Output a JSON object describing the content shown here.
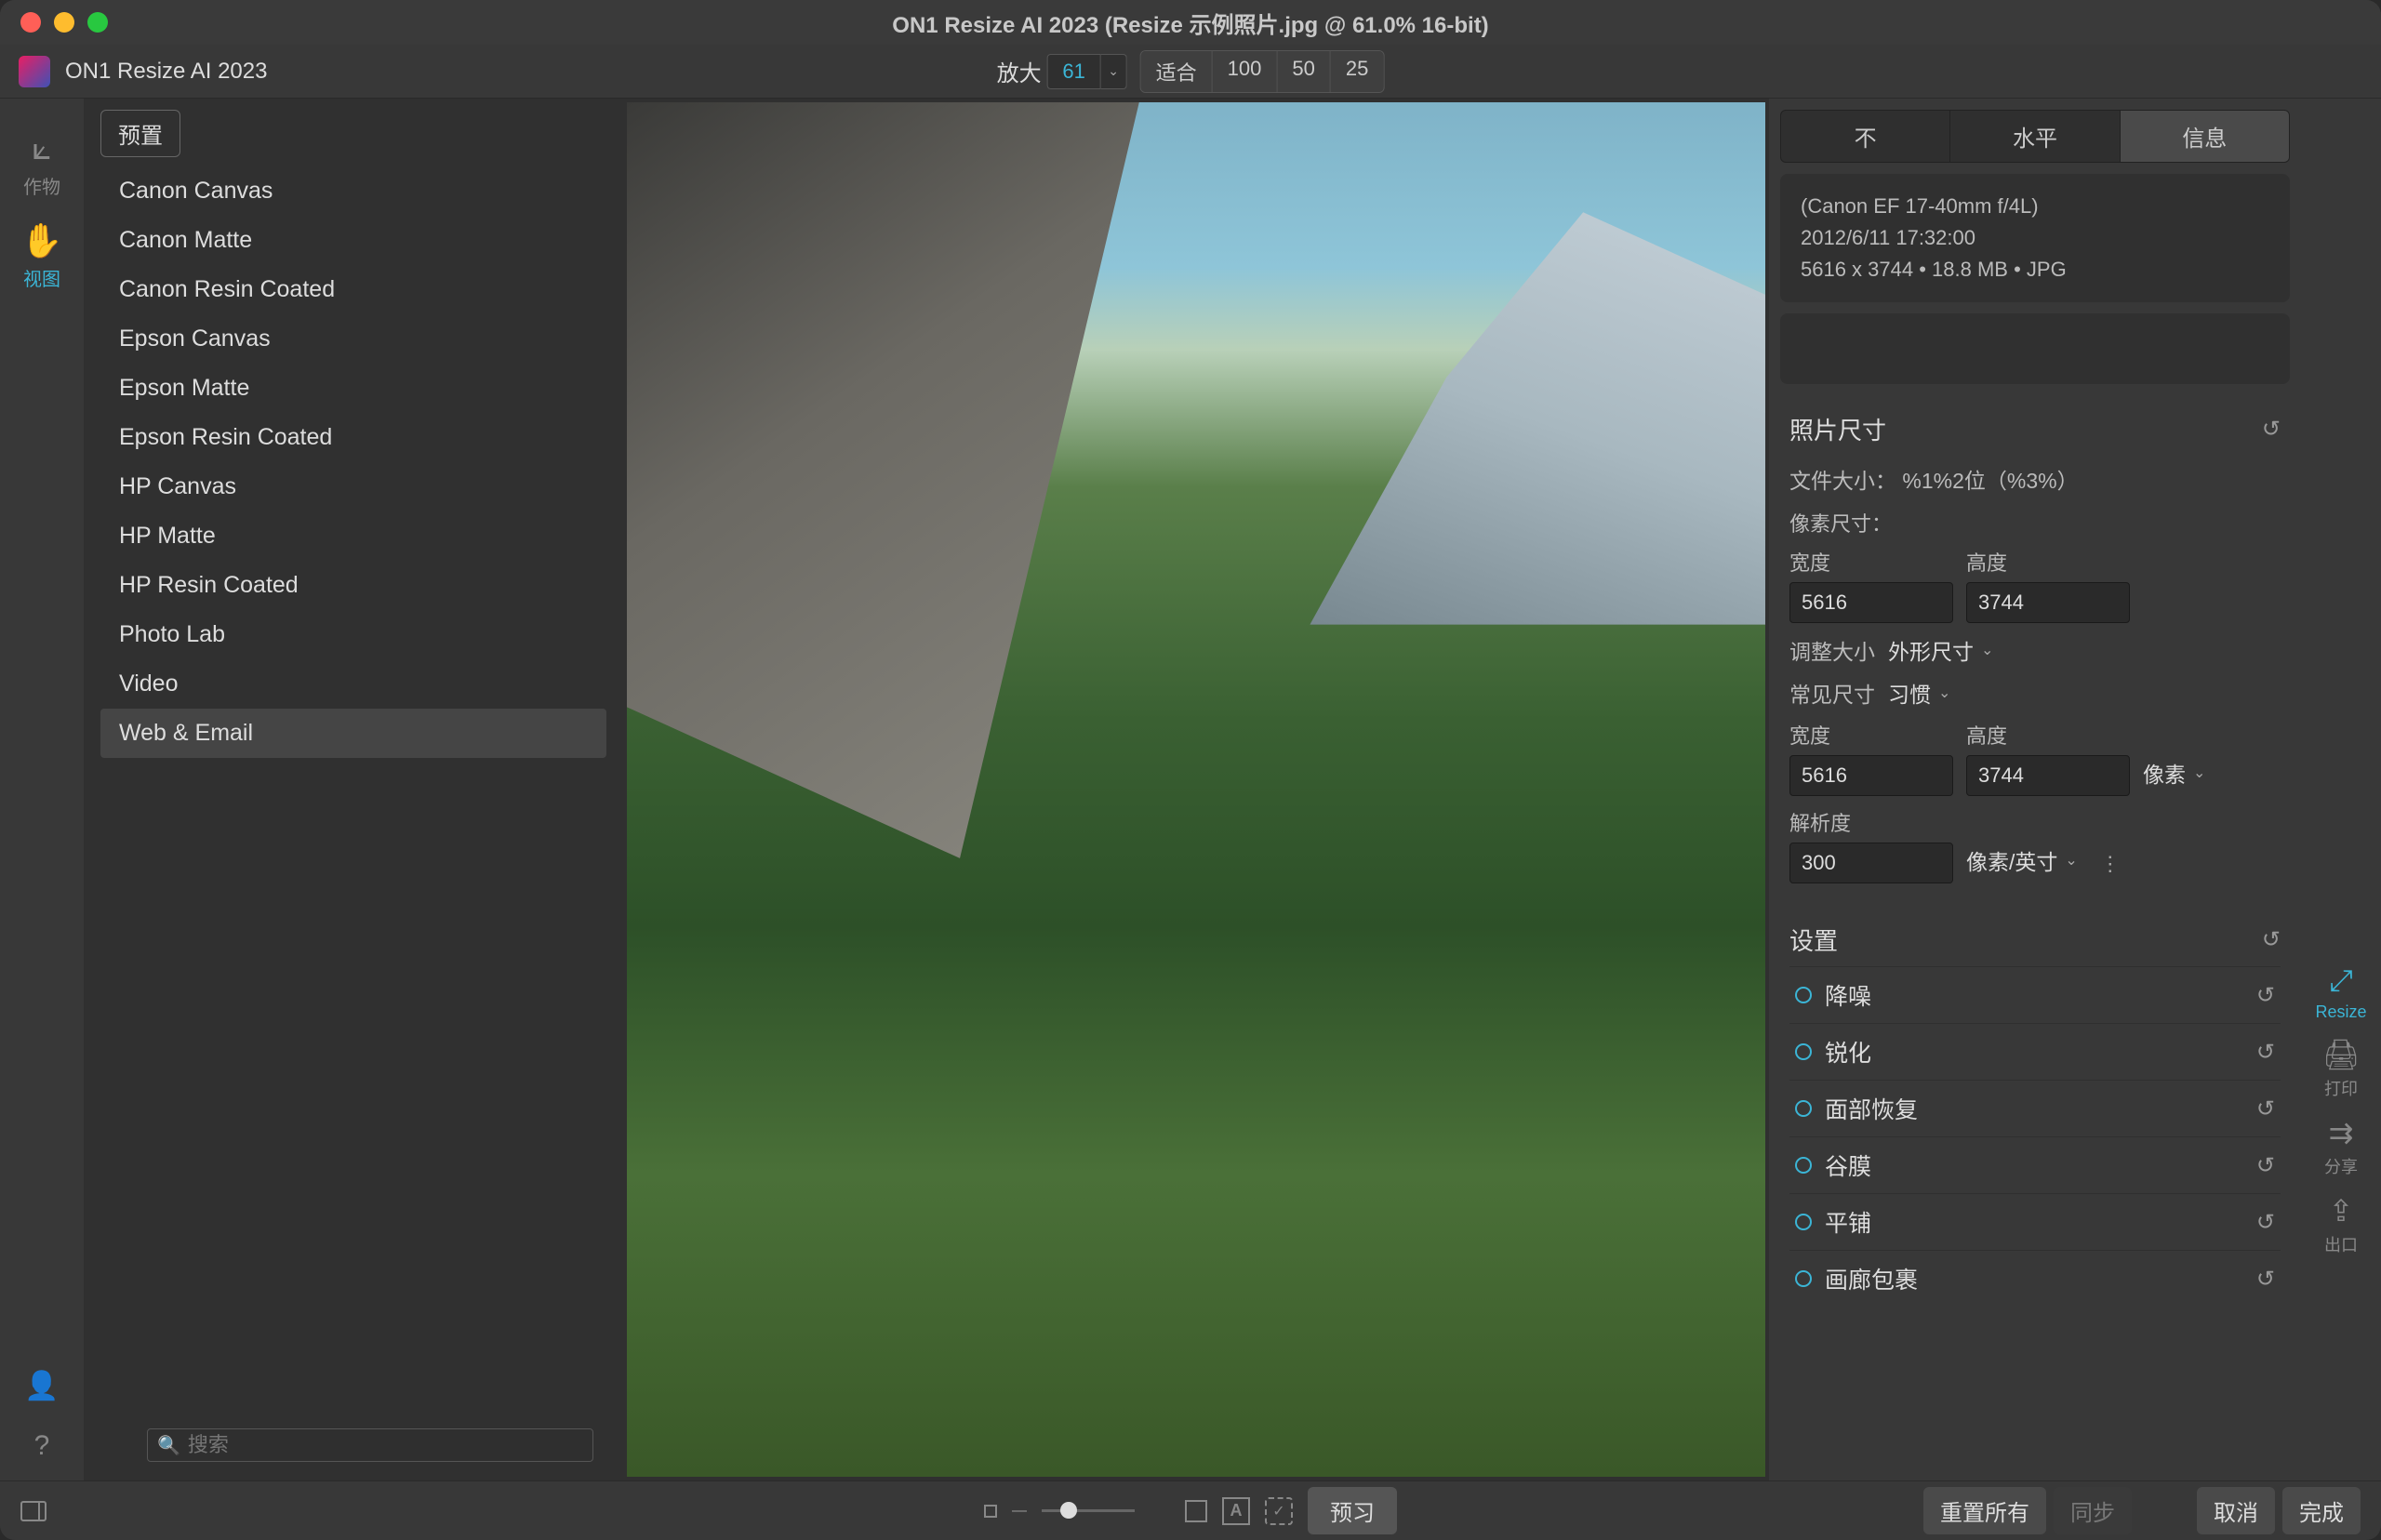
{
  "title": "ON1 Resize AI 2023 (Resize 示例照片.jpg @ 61.0% 16-bit)",
  "app_name": "ON1 Resize AI 2023",
  "toolbar": {
    "zoom_label": "放大",
    "zoom_value": "61",
    "zoom_buttons": [
      "适合",
      "100",
      "50",
      "25"
    ]
  },
  "left_rail": {
    "items": [
      {
        "label": "作物",
        "active": false
      },
      {
        "label": "视图",
        "active": true
      }
    ]
  },
  "presets": {
    "header": "预置",
    "items": [
      "Canon Canvas",
      "Canon Matte",
      "Canon Resin Coated",
      "Epson Canvas",
      "Epson Matte",
      "Epson Resin Coated",
      "HP Canvas",
      "HP Matte",
      "HP Resin Coated",
      "Photo Lab",
      "Video",
      "Web & Email"
    ],
    "selected_index": 11,
    "search_placeholder": "搜索"
  },
  "right_tabs": [
    "不",
    "水平",
    "信息"
  ],
  "right_tab_active": 2,
  "info": {
    "lens": "(Canon EF 17-40mm f/4L)",
    "datetime": "2012/6/11  17:32:00",
    "dims_line": "5616 x 3744  •  18.8 MB  •  JPG"
  },
  "photo_size": {
    "title": "照片尺寸",
    "file_size_label": "文件大小：  %1%2位（%3%）",
    "pixel_dims_label": "像素尺寸：",
    "width_label": "宽度",
    "height_label": "高度",
    "width_value": "5616",
    "height_value": "3744",
    "resize_label": "调整大小",
    "resize_mode": "外形尺寸",
    "common_label": "常见尺寸",
    "common_value": "习惯",
    "width_value2": "5616",
    "height_value2": "3744",
    "unit": "像素",
    "resolution_label": "解析度",
    "resolution_value": "300",
    "res_unit": "像素/英寸"
  },
  "settings": {
    "title": "设置",
    "items": [
      "降噪",
      "锐化",
      "面部恢复",
      "谷膜",
      "平铺",
      "画廊包裹"
    ]
  },
  "right_rail": {
    "items": [
      {
        "label": "Resize",
        "active": true
      },
      {
        "label": "打印",
        "active": false
      },
      {
        "label": "分享",
        "active": false
      },
      {
        "label": "出口",
        "active": false
      }
    ]
  },
  "footer": {
    "preview": "预习",
    "reset_all": "重置所有",
    "sync": "同步",
    "cancel": "取消",
    "done": "完成"
  }
}
